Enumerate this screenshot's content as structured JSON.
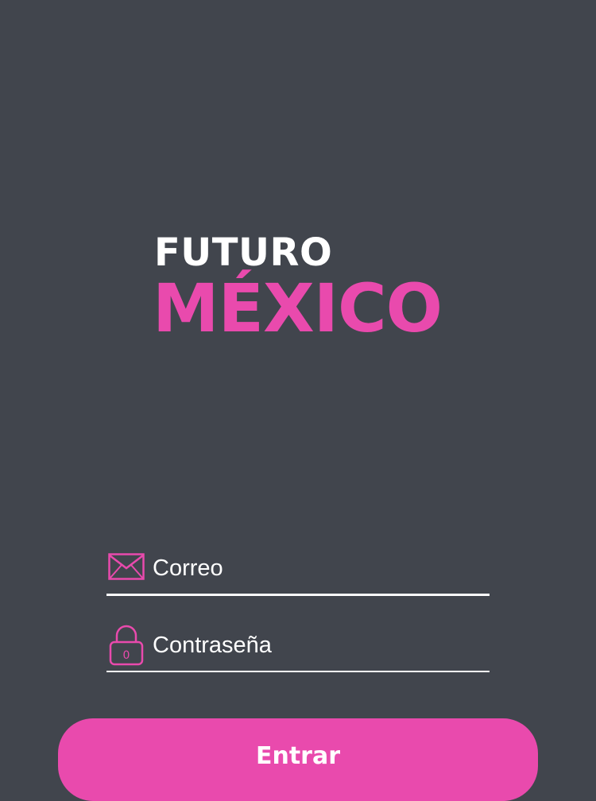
{
  "colors": {
    "background": "#41454d",
    "accent": "#e94aad",
    "text": "#ffffff"
  },
  "logo": {
    "line1": "FUTURO",
    "line2": "MÉXICO"
  },
  "form": {
    "email": {
      "icon": "envelope-icon",
      "placeholder": "Correo"
    },
    "password": {
      "icon": "lock-icon",
      "placeholder": "Contraseña"
    },
    "submit_label": "Entrar"
  }
}
